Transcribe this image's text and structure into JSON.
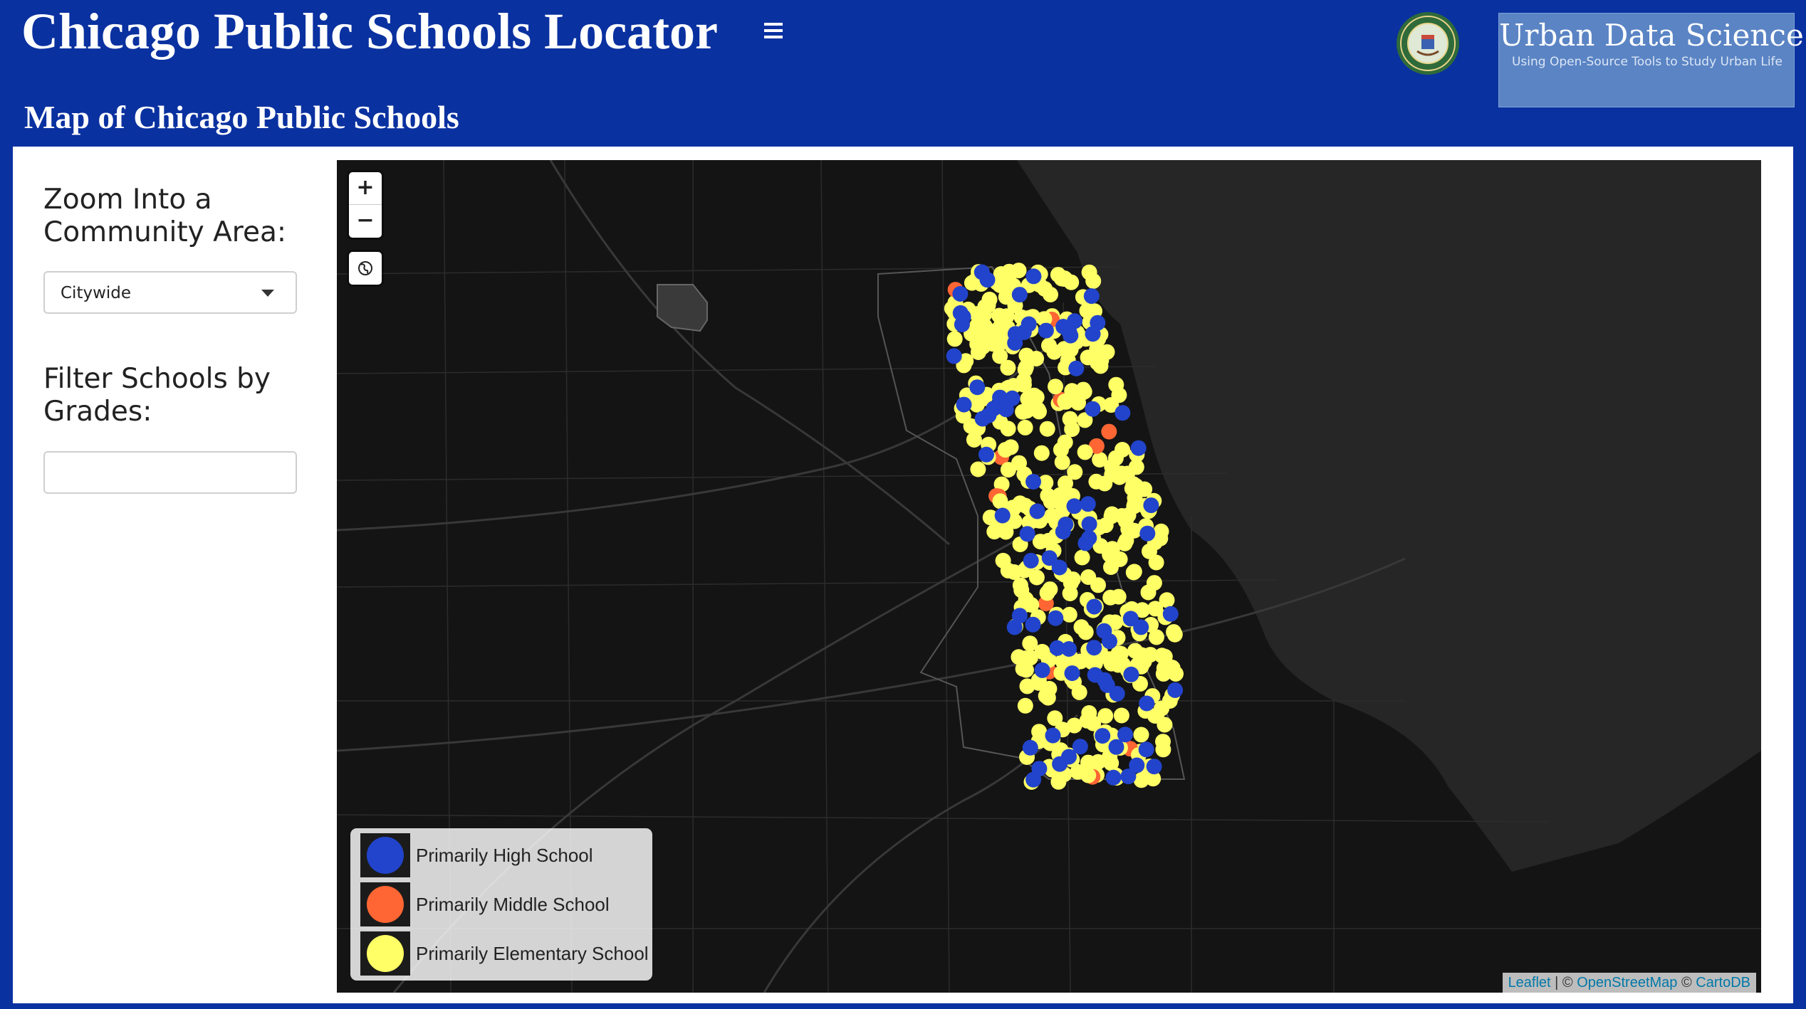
{
  "header": {
    "app_title": "Chicago Public Schools Locator",
    "menu_icon": "hamburger-menu-icon",
    "seal_icon": "city-of-chicago-seal",
    "brand_title": "Urban Data Science",
    "brand_subtitle": "Using Open-Source Tools to Study Urban Life"
  },
  "page": {
    "title": "Map of Chicago Public Schools"
  },
  "sidebar": {
    "zoom_label": "Zoom Into a Community Area:",
    "zoom_select_value": "Citywide",
    "filter_label": "Filter Schools by Grades:",
    "filter_value": ""
  },
  "map": {
    "zoom_in": "+",
    "zoom_out": "−",
    "reset_icon": "globe-icon",
    "background_color": "#141414",
    "water_color": "#262626",
    "legend": [
      {
        "label": "Primarily High School",
        "color": "#2244cc"
      },
      {
        "label": "Primarily Middle School",
        "color": "#ff6633"
      },
      {
        "label": "Primarily Elementary School",
        "color": "#ffff66"
      }
    ],
    "attribution": {
      "leaflet": "Leaflet",
      "separator": " | © ",
      "osm": "OpenStreetMap",
      "separator2": " © ",
      "carto": "CartoDB"
    }
  },
  "colors": {
    "header_bg": "#0a31a0",
    "high_school": "#2244cc",
    "middle_school": "#ff6633",
    "elementary_school": "#ffff66"
  }
}
